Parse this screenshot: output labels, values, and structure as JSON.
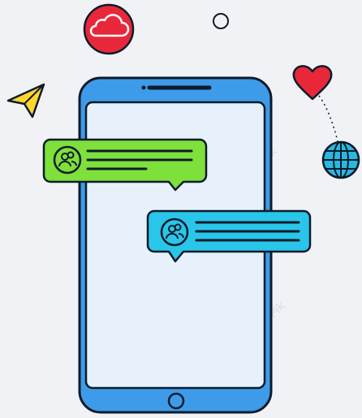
{
  "watermark": {
    "text": "LovePik"
  },
  "colors": {
    "background": "#f1f2f5",
    "outline": "#0d1b2a",
    "phone_body": "#3d9be9",
    "phone_screen": "#e6f1fb",
    "bubble_green": "#7ee03b",
    "bubble_cyan": "#29c6ea",
    "cloud_red": "#e8283a",
    "heart_red": "#e8283a",
    "plane_yellow": "#ffd52e",
    "globe_cyan": "#29b8e0"
  },
  "icons": {
    "cloud": "cloud-icon",
    "plane": "paper-plane-icon",
    "heart": "heart-icon",
    "globe": "globe-icon",
    "circle": "circle-icon",
    "avatar": "user-group-icon",
    "home": "home-button-icon"
  },
  "messages": [
    {
      "sender": "user-group",
      "color": "#7ee03b",
      "lines": 3
    },
    {
      "sender": "user-group",
      "color": "#29c6ea",
      "lines": 3
    }
  ]
}
